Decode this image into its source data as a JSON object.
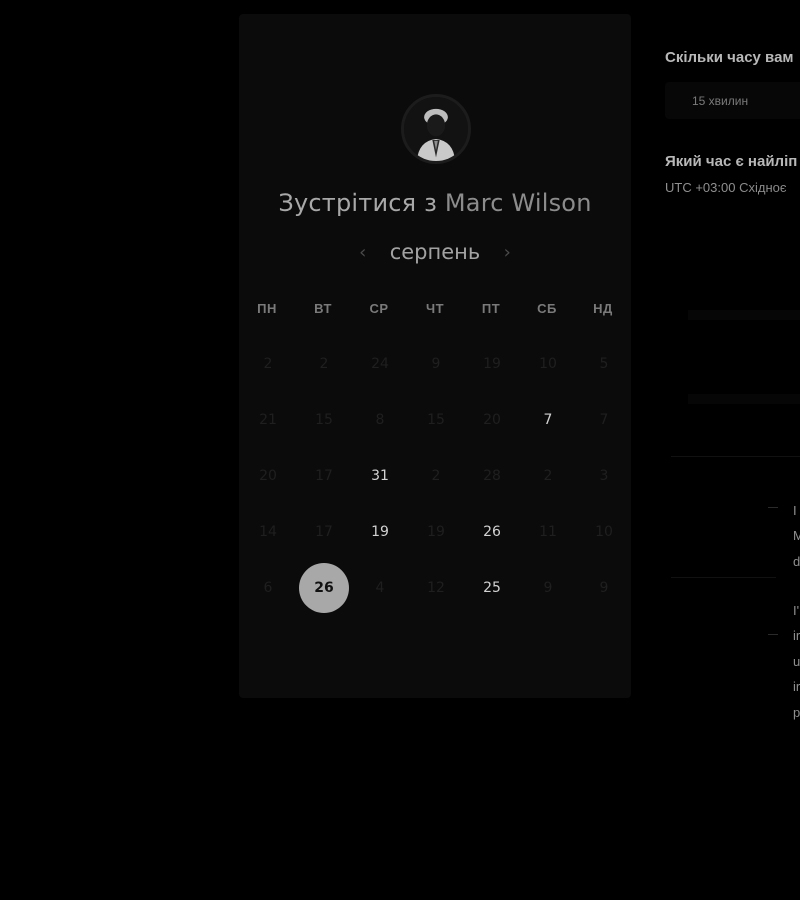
{
  "card": {
    "meet_prefix": "Зустрітися з ",
    "host_name": "Marc Wilson",
    "month": "серпень",
    "prev_arrow": "‹",
    "next_arrow": "›",
    "weekdays": [
      "ПН",
      "ВТ",
      "СР",
      "ЧТ",
      "ПТ",
      "СБ",
      "НД"
    ],
    "weeks": [
      [
        {
          "d": "2",
          "a": false
        },
        {
          "d": "2",
          "a": false
        },
        {
          "d": "24",
          "a": false
        },
        {
          "d": "9",
          "a": false
        },
        {
          "d": "19",
          "a": false
        },
        {
          "d": "10",
          "a": false
        },
        {
          "d": "5",
          "a": false
        }
      ],
      [
        {
          "d": "21",
          "a": false
        },
        {
          "d": "15",
          "a": false
        },
        {
          "d": "8",
          "a": false
        },
        {
          "d": "15",
          "a": false
        },
        {
          "d": "20",
          "a": false
        },
        {
          "d": "7",
          "a": true
        },
        {
          "d": "7",
          "a": false
        }
      ],
      [
        {
          "d": "20",
          "a": false
        },
        {
          "d": "17",
          "a": false
        },
        {
          "d": "31",
          "a": true
        },
        {
          "d": "2",
          "a": false
        },
        {
          "d": "28",
          "a": false
        },
        {
          "d": "2",
          "a": false
        },
        {
          "d": "3",
          "a": false
        }
      ],
      [
        {
          "d": "14",
          "a": false
        },
        {
          "d": "17",
          "a": false
        },
        {
          "d": "19",
          "a": true
        },
        {
          "d": "19",
          "a": false
        },
        {
          "d": "26",
          "a": true
        },
        {
          "d": "11",
          "a": false
        },
        {
          "d": "10",
          "a": false
        }
      ],
      [
        {
          "d": "6",
          "a": false
        },
        {
          "d": "26",
          "a": true,
          "sel": true
        },
        {
          "d": "4",
          "a": false
        },
        {
          "d": "12",
          "a": false
        },
        {
          "d": "25",
          "a": true
        },
        {
          "d": "9",
          "a": false
        },
        {
          "d": "9",
          "a": false
        }
      ]
    ]
  },
  "side": {
    "duration_question": "Скільки часу вам",
    "duration_option": "15 хвилин",
    "time_question": "Який час є найліп",
    "timezone_offset": "UTC +03:00",
    "timezone_name": "Східноє",
    "message_letters": [
      "I",
      "M",
      "d",
      "I'",
      "ir",
      "u",
      "ir",
      "p"
    ]
  }
}
